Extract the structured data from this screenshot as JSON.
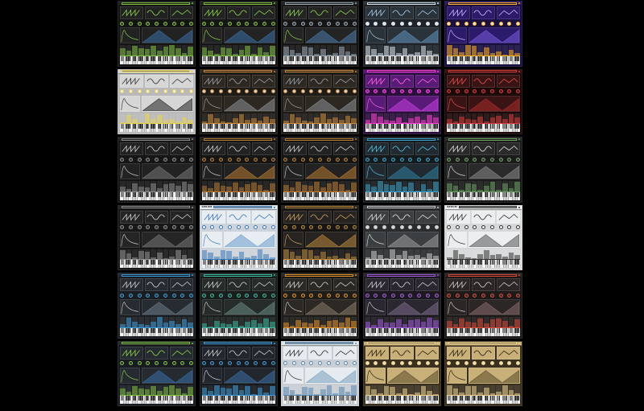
{
  "title": "",
  "tiles": [
    {
      "logo": "",
      "bg": "#141414",
      "panel": "#222222",
      "accent": "#7fbf3f",
      "knob": "#3a3a3a",
      "fg": "#bbbbbb",
      "wave": "#8ed04a",
      "env": "#3b6fa6"
    },
    {
      "logo": "",
      "bg": "#151515",
      "panel": "#232323",
      "accent": "#7fbf3f",
      "knob": "#3a3a3a",
      "fg": "#bbbbbb",
      "wave": "#8ed04a",
      "env": "#3b6fa6"
    },
    {
      "logo": "",
      "bg": "#151515",
      "panel": "#242424",
      "accent": "#9aa8b4",
      "knob": "#3a3a3a",
      "fg": "#bbbbbb",
      "wave": "#8ed04a",
      "env": "#4a7aa8"
    },
    {
      "logo": "",
      "bg": "#1d2328",
      "panel": "#2b333a",
      "accent": "#d8e2ea",
      "knob": "#e8e8e8",
      "fg": "#dddddd",
      "wave": "#a8c8e0",
      "env": "#5e8fb8"
    },
    {
      "logo": "",
      "bg": "#1a1040",
      "panel": "#2c1a6b",
      "accent": "#ffb020",
      "knob": "#e8e8e8",
      "fg": "#eeeeee",
      "wave": "#c9b8ff",
      "env": "#7a5bd8"
    },
    {
      "logo": "",
      "bg": "#b9b9b9",
      "panel": "#d6d6d6",
      "accent": "#e8d34a",
      "knob": "#f2f2f2",
      "fg": "#222222",
      "wave": "#333333",
      "env": "#222222"
    },
    {
      "logo": "",
      "bg": "#1f1b17",
      "panel": "#2e2822",
      "accent": "#c98a3a",
      "knob": "#d8d8d8",
      "fg": "#dddddd",
      "wave": "#9aa2a8",
      "env": "#8a8f94"
    },
    {
      "logo": "",
      "bg": "#1f1b17",
      "panel": "#2e2822",
      "accent": "#c98a3a",
      "knob": "#d8d8d8",
      "fg": "#dddddd",
      "wave": "#9aa2a8",
      "env": "#8a8f94"
    },
    {
      "logo": "",
      "bg": "#2a0f3a",
      "panel": "#5a1a78",
      "accent": "#ff3fcf",
      "knob": "#7a2aa0",
      "fg": "#f0d0ff",
      "wave": "#ff66e0",
      "env": "#c83fe0"
    },
    {
      "logo": "",
      "bg": "#1c0a0a",
      "panel": "#3a1414",
      "accent": "#d83a3a",
      "knob": "#4a1c1c",
      "fg": "#dddddd",
      "wave": "#e05050",
      "env": "#a82a2a"
    },
    {
      "logo": "",
      "bg": "#161616",
      "panel": "#222222",
      "accent": "#8a8a8a",
      "knob": "#333333",
      "fg": "#bbbbbb",
      "wave": "#cccccc",
      "env": "#777777"
    },
    {
      "logo": "",
      "bg": "#151515",
      "panel": "#222222",
      "accent": "#b87a30",
      "knob": "#333333",
      "fg": "#bbbbbb",
      "wave": "#cccccc",
      "env": "#b87a30"
    },
    {
      "logo": "",
      "bg": "#151515",
      "panel": "#222222",
      "accent": "#b87a30",
      "knob": "#333333",
      "fg": "#bbbbbb",
      "wave": "#cccccc",
      "env": "#b87a30"
    },
    {
      "logo": "",
      "bg": "#151a1d",
      "panel": "#202a30",
      "accent": "#3aa0c8",
      "knob": "#2c3a42",
      "fg": "#bbbbbb",
      "wave": "#5ac0e0",
      "env": "#2f7ea0"
    },
    {
      "logo": "",
      "bg": "#1b1b1b",
      "panel": "#2a2a2a",
      "accent": "#6aa060",
      "knob": "#3a3a3a",
      "fg": "#dddddd",
      "wave": "#dddddd",
      "env": "#888888"
    },
    {
      "logo": "",
      "bg": "#181818",
      "panel": "#252525",
      "accent": "#909090",
      "knob": "#333333",
      "fg": "#bbbbbb",
      "wave": "#cccccc",
      "env": "#777777"
    },
    {
      "logo": "SERUM",
      "bg": "#cdd3da",
      "panel": "#e8edf2",
      "accent": "#3a78b8",
      "knob": "#f4f4f4",
      "fg": "#222222",
      "wave": "#3a78b8",
      "env": "#6a9ccc"
    },
    {
      "logo": "",
      "bg": "#181614",
      "panel": "#262320",
      "accent": "#b8873a",
      "knob": "#333333",
      "fg": "#cccccc",
      "wave": "#c8a060",
      "env": "#b8873a"
    },
    {
      "logo": "",
      "bg": "#2a2c2e",
      "panel": "#3c3f42",
      "accent": "#c8c8c8",
      "knob": "#d8d8d8",
      "fg": "#dddddd",
      "wave": "#dddddd",
      "env": "#9a9a9a"
    },
    {
      "logo": "SERUM",
      "bg": "#d6d8da",
      "panel": "#eceeef",
      "accent": "#333333",
      "knob": "#f4f4f4",
      "fg": "#222222",
      "wave": "#333333",
      "env": "#555555"
    },
    {
      "logo": "",
      "bg": "#1a1e22",
      "panel": "#262c32",
      "accent": "#3a9ad8",
      "knob": "#30383f",
      "fg": "#bbbbbb",
      "wave": "#cccccc",
      "env": "#6a7a88"
    },
    {
      "logo": "",
      "bg": "#1a1e1d",
      "panel": "#262c2a",
      "accent": "#3ab8a0",
      "knob": "#303836",
      "fg": "#bbbbbb",
      "wave": "#cccccc",
      "env": "#6a8882"
    },
    {
      "logo": "",
      "bg": "#1e1c18",
      "panel": "#2c2924",
      "accent": "#e0902a",
      "knob": "#38342e",
      "fg": "#bbbbbb",
      "wave": "#cccccc",
      "env": "#887a6a"
    },
    {
      "logo": "",
      "bg": "#1c1a20",
      "panel": "#2a2730",
      "accent": "#a05ad8",
      "knob": "#35313d",
      "fg": "#bbbbbb",
      "wave": "#cccccc",
      "env": "#7a6a88"
    },
    {
      "logo": "",
      "bg": "#1e1a1a",
      "panel": "#2c2626",
      "accent": "#d8483a",
      "knob": "#383030",
      "fg": "#bbbbbb",
      "wave": "#cccccc",
      "env": "#886a6a"
    },
    {
      "logo": "",
      "bg": "#181c20",
      "panel": "#252b31",
      "accent": "#7fbf3f",
      "knob": "#30373e",
      "fg": "#bbbbbb",
      "wave": "#8ed04a",
      "env": "#3b6fa6"
    },
    {
      "logo": "",
      "bg": "#16191d",
      "panel": "#22272d",
      "accent": "#3a9ad8",
      "knob": "#2e343b",
      "fg": "#bbbbbb",
      "wave": "#cccccc",
      "env": "#3b6fa6"
    },
    {
      "logo": "",
      "bg": "#c8ced4",
      "panel": "#e6ebf0",
      "accent": "#5a88b0",
      "knob": "#f2f2f2",
      "fg": "#222222",
      "wave": "#333333",
      "env": "#7aa0c0"
    },
    {
      "logo": "",
      "bg": "#3a3020",
      "panel": "#c8b078",
      "accent": "#e8d090",
      "knob": "#efe2b8",
      "fg": "#2a2010",
      "wave": "#2a2010",
      "env": "#5a4a2a"
    },
    {
      "logo": "",
      "bg": "#3a3020",
      "panel": "#c8b078",
      "accent": "#e8d090",
      "knob": "#efe2b8",
      "fg": "#2a2010",
      "wave": "#2a2010",
      "env": "#5a4a2a"
    }
  ]
}
